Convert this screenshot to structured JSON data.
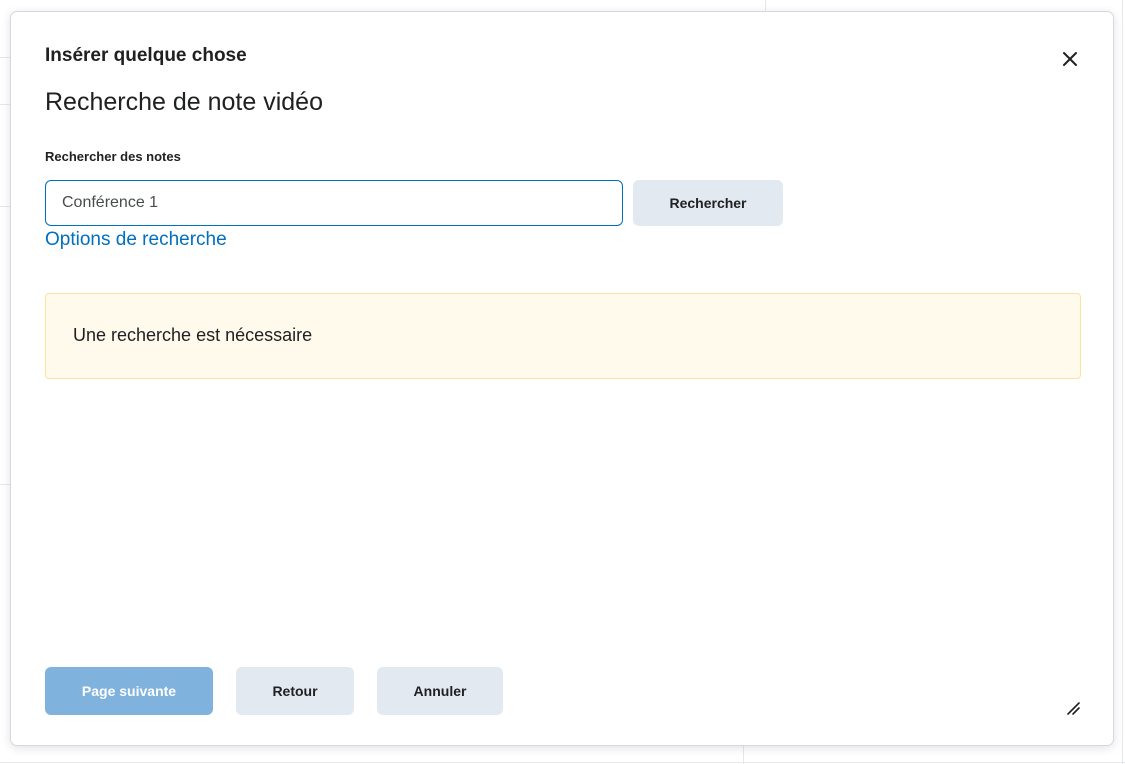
{
  "dialog": {
    "title": "Insérer quelque chose",
    "subtitle": "Recherche de note vidéo",
    "close_icon": "close-icon"
  },
  "search": {
    "label": "Rechercher des notes",
    "value": "Conférence 1",
    "button_label": "Rechercher",
    "options_link": "Options de recherche"
  },
  "alert": {
    "message": "Une recherche est nécessaire",
    "background_color": "#fffaeb",
    "border_color": "#fbe2a0"
  },
  "footer": {
    "next_label": "Page suivante",
    "back_label": "Retour",
    "cancel_label": "Annuler"
  },
  "colors": {
    "accent": "#006fbf",
    "primary_disabled": "#7fb3de",
    "secondary_button": "#e3e9f1"
  }
}
